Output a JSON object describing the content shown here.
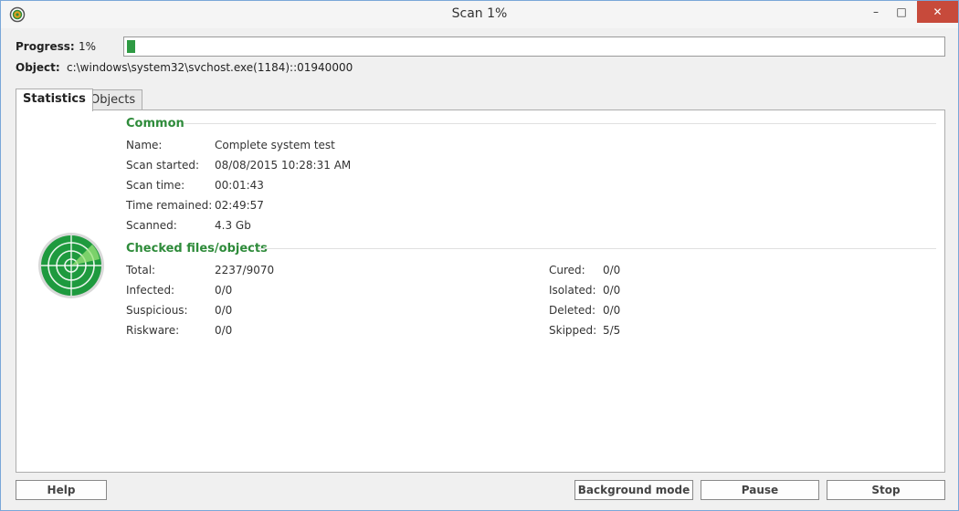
{
  "window": {
    "title": "Scan 1%",
    "minimize": "–",
    "maximize": "□",
    "close": "✕"
  },
  "progress": {
    "label": "Progress:",
    "percent_text": "1%",
    "fraction": 0.01
  },
  "object": {
    "label": "Object:",
    "value": "c:\\windows\\system32\\svchost.exe(1184)::01940000"
  },
  "tabs": [
    {
      "label": "Statistics",
      "active": true
    },
    {
      "label": "Objects",
      "active": false
    }
  ],
  "common": {
    "title": "Common",
    "rows": [
      {
        "label": "Name:",
        "value": "Complete system test"
      },
      {
        "label": "Scan started:",
        "value": "08/08/2015 10:28:31 AM"
      },
      {
        "label": "Scan time:",
        "value": "00:01:43"
      },
      {
        "label": "Time remained:",
        "value": "02:49:57"
      },
      {
        "label": "Scanned:",
        "value": "4.3 Gb"
      }
    ]
  },
  "checked": {
    "title": "Checked files/objects",
    "left_rows": [
      {
        "label": "Total:",
        "value": "2237/9070"
      },
      {
        "label": "Infected:",
        "value": "0/0"
      },
      {
        "label": "Suspicious:",
        "value": "0/0"
      },
      {
        "label": "Riskware:",
        "value": "0/0"
      }
    ],
    "right_rows": [
      {
        "label": "Cured:",
        "value": "0/0"
      },
      {
        "label": "Isolated:",
        "value": "0/0"
      },
      {
        "label": "Deleted:",
        "value": "0/0"
      },
      {
        "label": "Skipped:",
        "value": "5/5"
      }
    ]
  },
  "buttons": {
    "help": "Help",
    "background": "Background mode",
    "pause": "Pause",
    "stop": "Stop"
  },
  "colors": {
    "accent_green": "#2e8b3a",
    "progress_green": "#2e9a43",
    "close_red": "#c74a3b"
  },
  "icons": {
    "app": "scanner-app-icon",
    "radar": "radar-scan-icon"
  }
}
